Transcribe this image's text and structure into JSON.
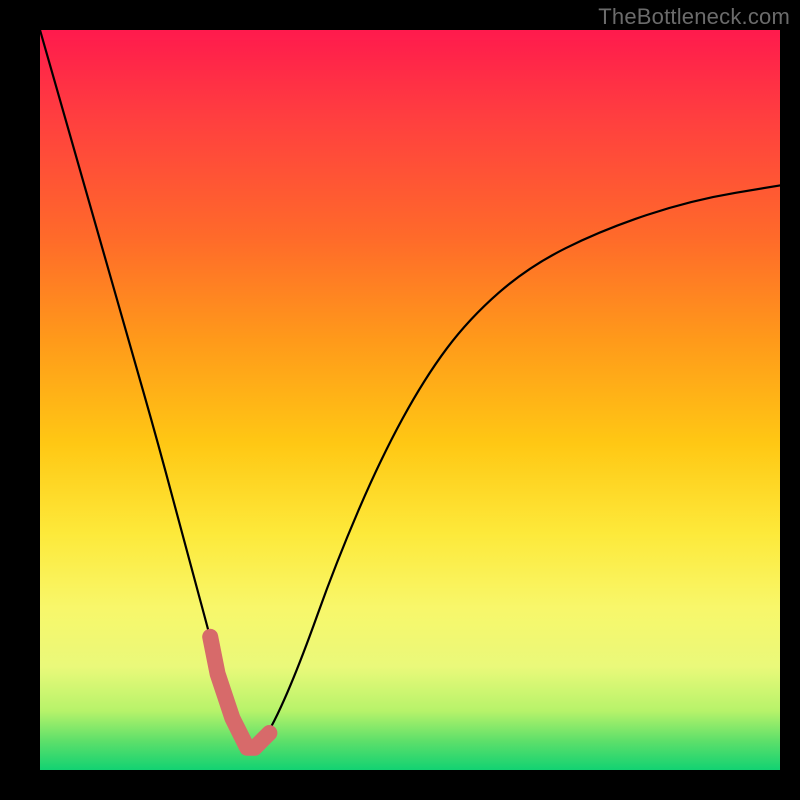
{
  "watermark": "TheBottleneck.com",
  "chart_data": {
    "type": "line",
    "title": "",
    "xlabel": "",
    "ylabel": "",
    "xlim": [
      0,
      100
    ],
    "ylim": [
      0,
      100
    ],
    "series": [
      {
        "name": "bottleneck-curve",
        "color": "#000000",
        "x": [
          0,
          4,
          8,
          12,
          16,
          20,
          23,
          25,
          27,
          29,
          31,
          35,
          40,
          46,
          52,
          58,
          66,
          76,
          88,
          100
        ],
        "values": [
          100,
          86,
          72,
          58,
          44,
          29,
          18,
          10,
          5,
          3,
          5,
          14,
          28,
          42,
          53,
          61,
          68,
          73,
          77,
          79
        ]
      },
      {
        "name": "near-zero-highlight",
        "color": "#d76a6a",
        "x": [
          23,
          24,
          25,
          26,
          27,
          28,
          29,
          30,
          31
        ],
        "values": [
          18,
          13,
          10,
          7,
          5,
          3,
          3,
          4,
          5
        ]
      }
    ],
    "colors": {
      "gradient_top": "#ff1a4d",
      "gradient_mid": "#ffd21a",
      "gradient_bottom": "#12d272",
      "curve": "#000000",
      "highlight": "#d76a6a",
      "frame": "#000000"
    }
  }
}
